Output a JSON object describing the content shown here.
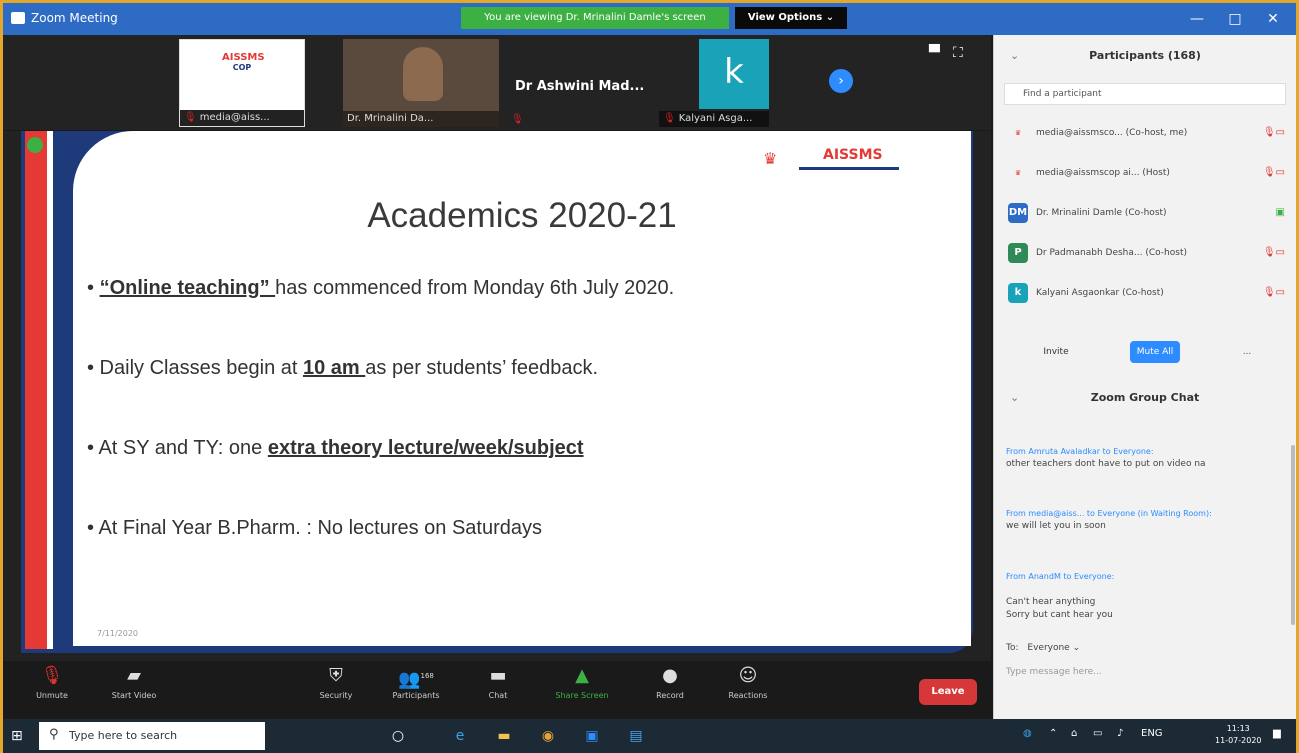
{
  "window": {
    "title": "Zoom Meeting",
    "share_banner": "You are viewing Dr. Mrinalini Damle's screen",
    "view_options": "View Options ⌄",
    "minimize": "—",
    "maximize": "□",
    "close": "✕"
  },
  "video_strip": {
    "tiles": [
      {
        "label": "media@aiss...",
        "logo": "AISSMS",
        "logo_sub": "COP"
      },
      {
        "label": "Dr. Mrinalini Da..."
      },
      {
        "name": "Dr Ashwini Mad..."
      },
      {
        "label": "Kalyani Asga...",
        "initial": "k"
      }
    ]
  },
  "slide": {
    "title": "Academics 2020-21",
    "logo_text": "AISSMS",
    "bullets": [
      {
        "pre": "• ",
        "bold": "“Online teaching” ",
        "post": "has commenced from Monday 6th July 2020."
      },
      {
        "pre": "• Daily Classes begin at ",
        "bold": "10 am ",
        "post": "as per students’ feedback."
      },
      {
        "pre": "• At SY and TY: one ",
        "bold": "extra theory lecture/week/subject",
        "post": ""
      },
      {
        "pre": "• At Final Year B.Pharm. : No lectures on Saturdays",
        "bold": "",
        "post": ""
      }
    ],
    "footer_date": "7/11/2020"
  },
  "toolbar": {
    "unmute": "Unmute",
    "start_video": "Start Video",
    "security": "Security",
    "participants": "Participants",
    "participants_count": "168",
    "chat": "Chat",
    "share_screen": "Share Screen",
    "record": "Record",
    "reactions": "Reactions",
    "leave": "Leave"
  },
  "participants_panel": {
    "title": "Participants (168)",
    "search_placeholder": "Find a participant",
    "items": [
      {
        "avatar": "AISSMS",
        "avatar_color": "#ffffff",
        "name": "media@aissmsco... (Co-host, me)"
      },
      {
        "avatar": "AISSMS",
        "avatar_color": "#ffffff",
        "name": "media@aissmscop ai... (Host)"
      },
      {
        "avatar": "DM",
        "avatar_color": "#2d6bc4",
        "name": "Dr. Mrinalini Damle (Co-host)"
      },
      {
        "avatar": "P",
        "avatar_color": "#2e8b57",
        "name": "Dr Padmanabh Desha... (Co-host)"
      },
      {
        "avatar": "k",
        "avatar_color": "#1aa3b8",
        "name": "Kalyani Asgaonkar (Co-host)"
      }
    ],
    "invite": "Invite",
    "mute_all": "Mute All",
    "more": "..."
  },
  "chat": {
    "title": "Zoom Group Chat",
    "messages": [
      {
        "from": "From Amruta Avaladkar to Everyone:",
        "text": "other teachers dont have to put on video na"
      },
      {
        "from": "From media@aiss... to Everyone (in Waiting Room):",
        "text": "we will let you in soon"
      },
      {
        "from": "From AnandM to Everyone:",
        "text": "Can't hear anything\nSorry but cant hear you"
      }
    ],
    "to_label": "To:",
    "to_value": "Everyone ⌄",
    "input_placeholder": "Type message here..."
  },
  "taskbar": {
    "search_placeholder": "Type here to search",
    "lang": "ENG",
    "time": "11:13",
    "date": "11-07-2020"
  }
}
